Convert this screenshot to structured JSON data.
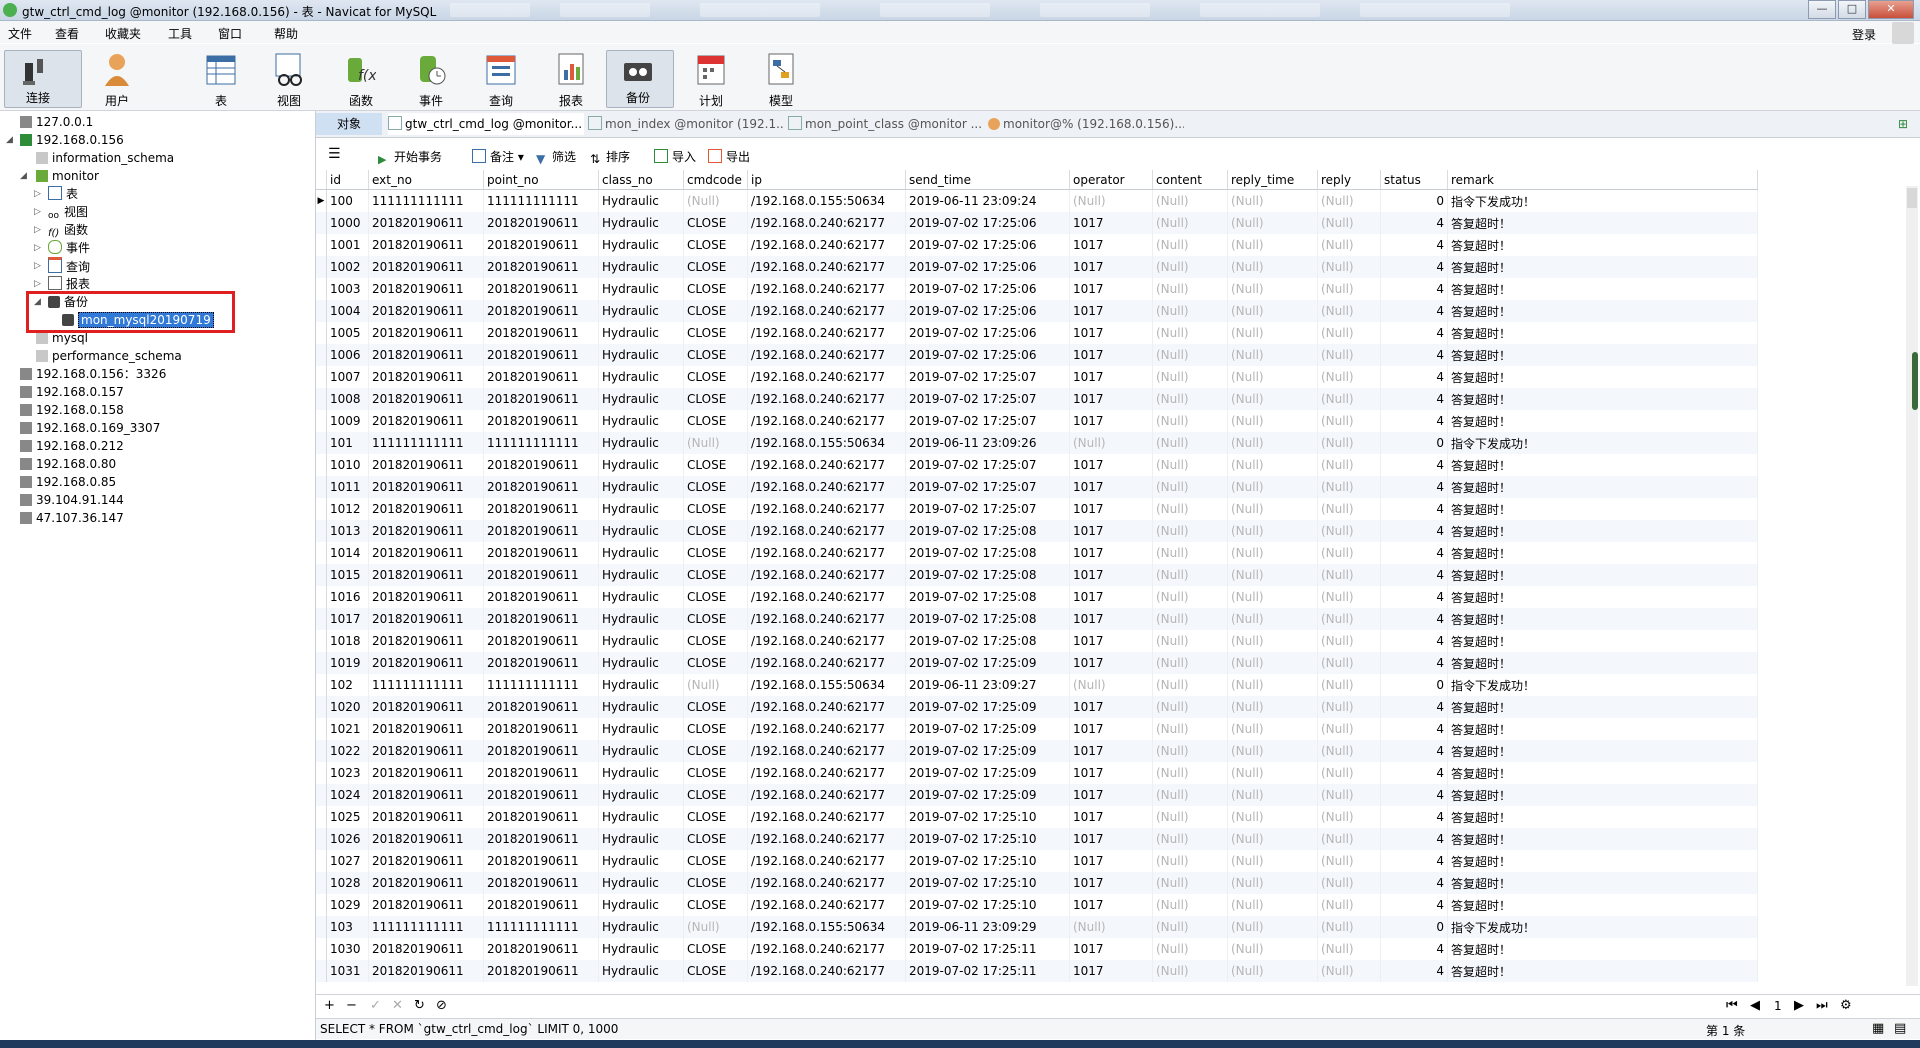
{
  "window": {
    "title": "gtw_ctrl_cmd_log @monitor (192.168.0.156) - 表 - Navicat for MySQL",
    "min": "—",
    "max": "□",
    "close": "✕"
  },
  "menu": [
    "文件",
    "查看",
    "收藏夹",
    "工具",
    "窗口",
    "帮助"
  ],
  "login": "登录",
  "toolbar": {
    "connect": "连接",
    "user": "用户",
    "table": "表",
    "view": "视图",
    "function": "函数",
    "event": "事件",
    "query": "查询",
    "report": "报表",
    "backup": "备份",
    "schedule": "计划",
    "model": "模型"
  },
  "tree": {
    "conn1": "127.0.0.1",
    "conn2": "192.168.0.156",
    "db_info": "information_schema",
    "db_monitor": "monitor",
    "n_table": "表",
    "n_view": "视图",
    "n_func": "函数",
    "n_event": "事件",
    "n_query": "查询",
    "n_report": "报表",
    "n_backup": "备份",
    "backup_item": "mon_mysql20190719",
    "db_mysql": "mysql",
    "db_perf": "performance_schema",
    "others": [
      "192.168.0.156：3326",
      "192.168.0.157",
      "192.168.0.158",
      "192.168.0.169_3307",
      "192.168.0.212",
      "192.168.0.80",
      "192.168.0.85",
      "39.104.91.144",
      "47.107.36.147"
    ]
  },
  "tabs": {
    "objects": "对象",
    "t1": "gtw_ctrl_cmd_log @monitor...",
    "t2": "mon_index @monitor (192.1...",
    "t3": "mon_point_class @monitor ...",
    "t4": "monitor@% (192.168.0.156)..."
  },
  "subtoolbar": {
    "begin": "开始事务",
    "note": "备注",
    "filter": "筛选",
    "sort": "排序",
    "import": "导入",
    "export": "导出"
  },
  "columns": [
    "id",
    "ext_no",
    "point_no",
    "class_no",
    "cmdcode",
    "ip",
    "send_time",
    "operator",
    "content",
    "reply_time",
    "reply",
    "status",
    "remark"
  ],
  "rows": [
    [
      "100",
      "111111111111",
      "111111111111",
      "Hydraulic",
      "(Null)",
      "/192.168.0.155:50634",
      "2019-06-11 23:09:24",
      "(Null)",
      "(Null)",
      "(Null)",
      "(Null)",
      "0",
      "指令下发成功！"
    ],
    [
      "1000",
      "201820190611",
      "201820190611",
      "Hydraulic",
      "CLOSE",
      "/192.168.0.240:62177",
      "2019-07-02 17:25:06",
      "1017",
      "(Null)",
      "(Null)",
      "(Null)",
      "4",
      "答复超时！"
    ],
    [
      "1001",
      "201820190611",
      "201820190611",
      "Hydraulic",
      "CLOSE",
      "/192.168.0.240:62177",
      "2019-07-02 17:25:06",
      "1017",
      "(Null)",
      "(Null)",
      "(Null)",
      "4",
      "答复超时！"
    ],
    [
      "1002",
      "201820190611",
      "201820190611",
      "Hydraulic",
      "CLOSE",
      "/192.168.0.240:62177",
      "2019-07-02 17:25:06",
      "1017",
      "(Null)",
      "(Null)",
      "(Null)",
      "4",
      "答复超时！"
    ],
    [
      "1003",
      "201820190611",
      "201820190611",
      "Hydraulic",
      "CLOSE",
      "/192.168.0.240:62177",
      "2019-07-02 17:25:06",
      "1017",
      "(Null)",
      "(Null)",
      "(Null)",
      "4",
      "答复超时！"
    ],
    [
      "1004",
      "201820190611",
      "201820190611",
      "Hydraulic",
      "CLOSE",
      "/192.168.0.240:62177",
      "2019-07-02 17:25:06",
      "1017",
      "(Null)",
      "(Null)",
      "(Null)",
      "4",
      "答复超时！"
    ],
    [
      "1005",
      "201820190611",
      "201820190611",
      "Hydraulic",
      "CLOSE",
      "/192.168.0.240:62177",
      "2019-07-02 17:25:06",
      "1017",
      "(Null)",
      "(Null)",
      "(Null)",
      "4",
      "答复超时！"
    ],
    [
      "1006",
      "201820190611",
      "201820190611",
      "Hydraulic",
      "CLOSE",
      "/192.168.0.240:62177",
      "2019-07-02 17:25:06",
      "1017",
      "(Null)",
      "(Null)",
      "(Null)",
      "4",
      "答复超时！"
    ],
    [
      "1007",
      "201820190611",
      "201820190611",
      "Hydraulic",
      "CLOSE",
      "/192.168.0.240:62177",
      "2019-07-02 17:25:07",
      "1017",
      "(Null)",
      "(Null)",
      "(Null)",
      "4",
      "答复超时！"
    ],
    [
      "1008",
      "201820190611",
      "201820190611",
      "Hydraulic",
      "CLOSE",
      "/192.168.0.240:62177",
      "2019-07-02 17:25:07",
      "1017",
      "(Null)",
      "(Null)",
      "(Null)",
      "4",
      "答复超时！"
    ],
    [
      "1009",
      "201820190611",
      "201820190611",
      "Hydraulic",
      "CLOSE",
      "/192.168.0.240:62177",
      "2019-07-02 17:25:07",
      "1017",
      "(Null)",
      "(Null)",
      "(Null)",
      "4",
      "答复超时！"
    ],
    [
      "101",
      "111111111111",
      "111111111111",
      "Hydraulic",
      "(Null)",
      "/192.168.0.155:50634",
      "2019-06-11 23:09:26",
      "(Null)",
      "(Null)",
      "(Null)",
      "(Null)",
      "0",
      "指令下发成功！"
    ],
    [
      "1010",
      "201820190611",
      "201820190611",
      "Hydraulic",
      "CLOSE",
      "/192.168.0.240:62177",
      "2019-07-02 17:25:07",
      "1017",
      "(Null)",
      "(Null)",
      "(Null)",
      "4",
      "答复超时！"
    ],
    [
      "1011",
      "201820190611",
      "201820190611",
      "Hydraulic",
      "CLOSE",
      "/192.168.0.240:62177",
      "2019-07-02 17:25:07",
      "1017",
      "(Null)",
      "(Null)",
      "(Null)",
      "4",
      "答复超时！"
    ],
    [
      "1012",
      "201820190611",
      "201820190611",
      "Hydraulic",
      "CLOSE",
      "/192.168.0.240:62177",
      "2019-07-02 17:25:07",
      "1017",
      "(Null)",
      "(Null)",
      "(Null)",
      "4",
      "答复超时！"
    ],
    [
      "1013",
      "201820190611",
      "201820190611",
      "Hydraulic",
      "CLOSE",
      "/192.168.0.240:62177",
      "2019-07-02 17:25:08",
      "1017",
      "(Null)",
      "(Null)",
      "(Null)",
      "4",
      "答复超时！"
    ],
    [
      "1014",
      "201820190611",
      "201820190611",
      "Hydraulic",
      "CLOSE",
      "/192.168.0.240:62177",
      "2019-07-02 17:25:08",
      "1017",
      "(Null)",
      "(Null)",
      "(Null)",
      "4",
      "答复超时！"
    ],
    [
      "1015",
      "201820190611",
      "201820190611",
      "Hydraulic",
      "CLOSE",
      "/192.168.0.240:62177",
      "2019-07-02 17:25:08",
      "1017",
      "(Null)",
      "(Null)",
      "(Null)",
      "4",
      "答复超时！"
    ],
    [
      "1016",
      "201820190611",
      "201820190611",
      "Hydraulic",
      "CLOSE",
      "/192.168.0.240:62177",
      "2019-07-02 17:25:08",
      "1017",
      "(Null)",
      "(Null)",
      "(Null)",
      "4",
      "答复超时！"
    ],
    [
      "1017",
      "201820190611",
      "201820190611",
      "Hydraulic",
      "CLOSE",
      "/192.168.0.240:62177",
      "2019-07-02 17:25:08",
      "1017",
      "(Null)",
      "(Null)",
      "(Null)",
      "4",
      "答复超时！"
    ],
    [
      "1018",
      "201820190611",
      "201820190611",
      "Hydraulic",
      "CLOSE",
      "/192.168.0.240:62177",
      "2019-07-02 17:25:08",
      "1017",
      "(Null)",
      "(Null)",
      "(Null)",
      "4",
      "答复超时！"
    ],
    [
      "1019",
      "201820190611",
      "201820190611",
      "Hydraulic",
      "CLOSE",
      "/192.168.0.240:62177",
      "2019-07-02 17:25:09",
      "1017",
      "(Null)",
      "(Null)",
      "(Null)",
      "4",
      "答复超时！"
    ],
    [
      "102",
      "111111111111",
      "111111111111",
      "Hydraulic",
      "(Null)",
      "/192.168.0.155:50634",
      "2019-06-11 23:09:27",
      "(Null)",
      "(Null)",
      "(Null)",
      "(Null)",
      "0",
      "指令下发成功！"
    ],
    [
      "1020",
      "201820190611",
      "201820190611",
      "Hydraulic",
      "CLOSE",
      "/192.168.0.240:62177",
      "2019-07-02 17:25:09",
      "1017",
      "(Null)",
      "(Null)",
      "(Null)",
      "4",
      "答复超时！"
    ],
    [
      "1021",
      "201820190611",
      "201820190611",
      "Hydraulic",
      "CLOSE",
      "/192.168.0.240:62177",
      "2019-07-02 17:25:09",
      "1017",
      "(Null)",
      "(Null)",
      "(Null)",
      "4",
      "答复超时！"
    ],
    [
      "1022",
      "201820190611",
      "201820190611",
      "Hydraulic",
      "CLOSE",
      "/192.168.0.240:62177",
      "2019-07-02 17:25:09",
      "1017",
      "(Null)",
      "(Null)",
      "(Null)",
      "4",
      "答复超时！"
    ],
    [
      "1023",
      "201820190611",
      "201820190611",
      "Hydraulic",
      "CLOSE",
      "/192.168.0.240:62177",
      "2019-07-02 17:25:09",
      "1017",
      "(Null)",
      "(Null)",
      "(Null)",
      "4",
      "答复超时！"
    ],
    [
      "1024",
      "201820190611",
      "201820190611",
      "Hydraulic",
      "CLOSE",
      "/192.168.0.240:62177",
      "2019-07-02 17:25:09",
      "1017",
      "(Null)",
      "(Null)",
      "(Null)",
      "4",
      "答复超时！"
    ],
    [
      "1025",
      "201820190611",
      "201820190611",
      "Hydraulic",
      "CLOSE",
      "/192.168.0.240:62177",
      "2019-07-02 17:25:10",
      "1017",
      "(Null)",
      "(Null)",
      "(Null)",
      "4",
      "答复超时！"
    ],
    [
      "1026",
      "201820190611",
      "201820190611",
      "Hydraulic",
      "CLOSE",
      "/192.168.0.240:62177",
      "2019-07-02 17:25:10",
      "1017",
      "(Null)",
      "(Null)",
      "(Null)",
      "4",
      "答复超时！"
    ],
    [
      "1027",
      "201820190611",
      "201820190611",
      "Hydraulic",
      "CLOSE",
      "/192.168.0.240:62177",
      "2019-07-02 17:25:10",
      "1017",
      "(Null)",
      "(Null)",
      "(Null)",
      "4",
      "答复超时！"
    ],
    [
      "1028",
      "201820190611",
      "201820190611",
      "Hydraulic",
      "CLOSE",
      "/192.168.0.240:62177",
      "2019-07-02 17:25:10",
      "1017",
      "(Null)",
      "(Null)",
      "(Null)",
      "4",
      "答复超时！"
    ],
    [
      "1029",
      "201820190611",
      "201820190611",
      "Hydraulic",
      "CLOSE",
      "/192.168.0.240:62177",
      "2019-07-02 17:25:10",
      "1017",
      "(Null)",
      "(Null)",
      "(Null)",
      "4",
      "答复超时！"
    ],
    [
      "103",
      "111111111111",
      "111111111111",
      "Hydraulic",
      "(Null)",
      "/192.168.0.155:50634",
      "2019-06-11 23:09:29",
      "(Null)",
      "(Null)",
      "(Null)",
      "(Null)",
      "0",
      "指令下发成功！"
    ],
    [
      "1030",
      "201820190611",
      "201820190611",
      "Hydraulic",
      "CLOSE",
      "/192.168.0.240:62177",
      "2019-07-02 17:25:11",
      "1017",
      "(Null)",
      "(Null)",
      "(Null)",
      "4",
      "答复超时！"
    ],
    [
      "1031",
      "201820190611",
      "201820190611",
      "Hydraulic",
      "CLOSE",
      "/192.168.0.240:62177",
      "2019-07-02 17:25:11",
      "1017",
      "(Null)",
      "(Null)",
      "(Null)",
      "4",
      "答复超时！"
    ]
  ],
  "pager": {
    "page": "1"
  },
  "status": {
    "sql": "SELECT * FROM `gtw_ctrl_cmd_log` LIMIT 0, 1000",
    "record": "第 1 条"
  },
  "colors": {
    "selection": "#3179d6",
    "highlight_box": "#e02020",
    "null_text": "#b5b5b5"
  }
}
